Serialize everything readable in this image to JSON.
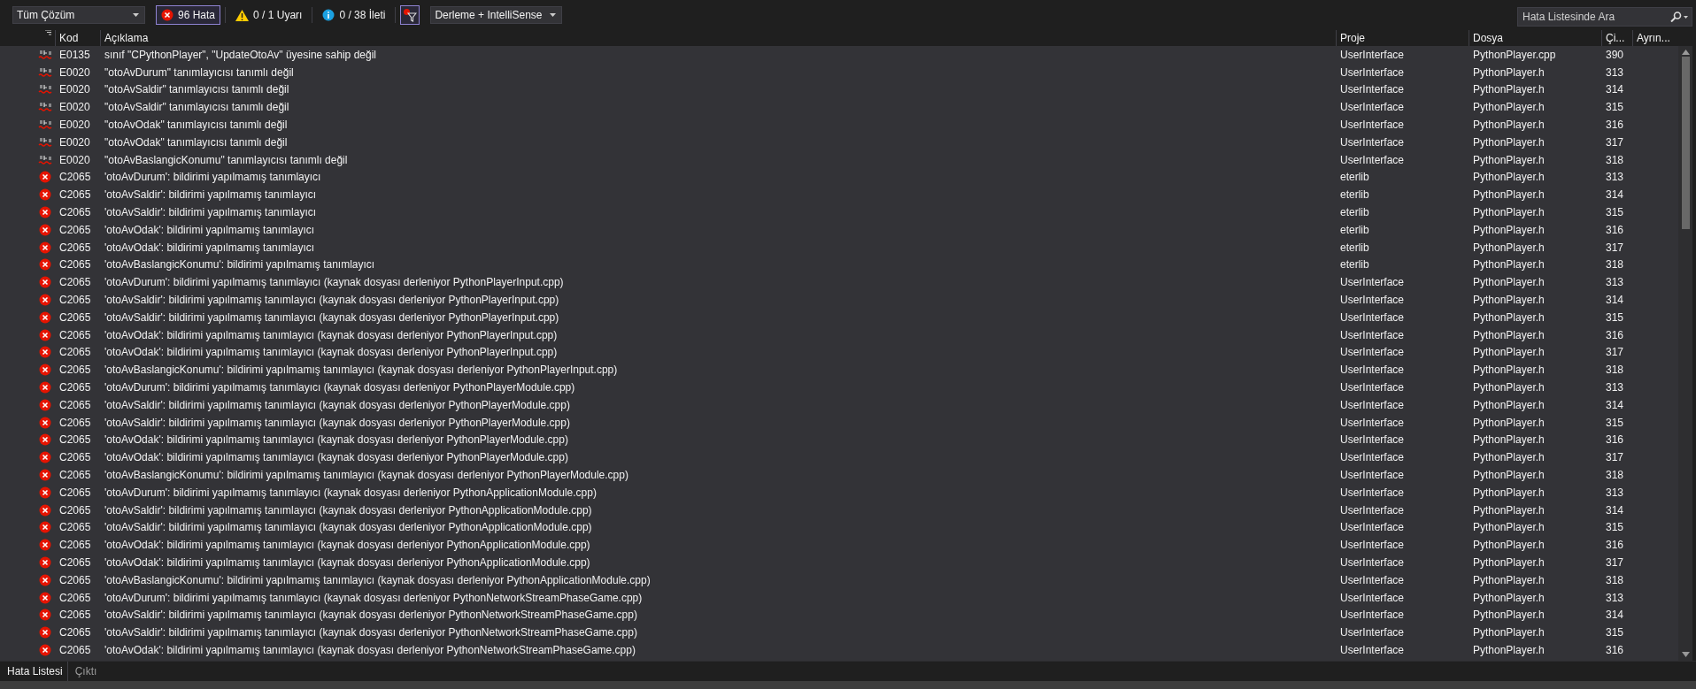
{
  "toolbar": {
    "scope": "Tüm Çözüm",
    "filters": [
      {
        "kind": "error",
        "label": "96 Hata",
        "selected": true
      },
      {
        "kind": "warning",
        "label": "0 / 1 Uyarı",
        "selected": false
      },
      {
        "kind": "info",
        "label": "0 / 38 İleti",
        "selected": false
      }
    ],
    "filter_toggle": {
      "selected": true
    },
    "build_source": "Derleme + IntelliSense",
    "search": {
      "placeholder": "Hata Listesinde Ara"
    }
  },
  "table": {
    "columns": [
      "Kod",
      "Açıklama",
      "Proje",
      "Dosya",
      "Çi...",
      "Ayrın..."
    ],
    "rows": [
      {
        "kind": "intellisense",
        "code": "E0135",
        "description": "sınıf \"CPythonPlayer\", \"UpdateOtoAv\" üyesine sahip değil",
        "project": "UserInterface",
        "file": "PythonPlayer.cpp",
        "line": "390"
      },
      {
        "kind": "intellisense",
        "code": "E0020",
        "description": "\"otoAvDurum\" tanımlayıcısı tanımlı değil",
        "project": "UserInterface",
        "file": "PythonPlayer.h",
        "line": "313"
      },
      {
        "kind": "intellisense",
        "code": "E0020",
        "description": "\"otoAvSaldir\" tanımlayıcısı tanımlı değil",
        "project": "UserInterface",
        "file": "PythonPlayer.h",
        "line": "314"
      },
      {
        "kind": "intellisense",
        "code": "E0020",
        "description": "\"otoAvSaldir\" tanımlayıcısı tanımlı değil",
        "project": "UserInterface",
        "file": "PythonPlayer.h",
        "line": "315"
      },
      {
        "kind": "intellisense",
        "code": "E0020",
        "description": "\"otoAvOdak\" tanımlayıcısı tanımlı değil",
        "project": "UserInterface",
        "file": "PythonPlayer.h",
        "line": "316"
      },
      {
        "kind": "intellisense",
        "code": "E0020",
        "description": "\"otoAvOdak\" tanımlayıcısı tanımlı değil",
        "project": "UserInterface",
        "file": "PythonPlayer.h",
        "line": "317"
      },
      {
        "kind": "intellisense",
        "code": "E0020",
        "description": "\"otoAvBaslangicKonumu\" tanımlayıcısı tanımlı değil",
        "project": "UserInterface",
        "file": "PythonPlayer.h",
        "line": "318"
      },
      {
        "kind": "error",
        "code": "C2065",
        "description": "'otoAvDurum': bildirimi yapılmamış tanımlayıcı",
        "project": "eterlib",
        "file": "PythonPlayer.h",
        "line": "313"
      },
      {
        "kind": "error",
        "code": "C2065",
        "description": "'otoAvSaldir': bildirimi yapılmamış tanımlayıcı",
        "project": "eterlib",
        "file": "PythonPlayer.h",
        "line": "314"
      },
      {
        "kind": "error",
        "code": "C2065",
        "description": "'otoAvSaldir': bildirimi yapılmamış tanımlayıcı",
        "project": "eterlib",
        "file": "PythonPlayer.h",
        "line": "315"
      },
      {
        "kind": "error",
        "code": "C2065",
        "description": "'otoAvOdak': bildirimi yapılmamış tanımlayıcı",
        "project": "eterlib",
        "file": "PythonPlayer.h",
        "line": "316"
      },
      {
        "kind": "error",
        "code": "C2065",
        "description": "'otoAvOdak': bildirimi yapılmamış tanımlayıcı",
        "project": "eterlib",
        "file": "PythonPlayer.h",
        "line": "317"
      },
      {
        "kind": "error",
        "code": "C2065",
        "description": "'otoAvBaslangicKonumu': bildirimi yapılmamış tanımlayıcı",
        "project": "eterlib",
        "file": "PythonPlayer.h",
        "line": "318"
      },
      {
        "kind": "error",
        "code": "C2065",
        "description": "'otoAvDurum': bildirimi yapılmamış tanımlayıcı (kaynak dosyası derleniyor PythonPlayerInput.cpp)",
        "project": "UserInterface",
        "file": "PythonPlayer.h",
        "line": "313"
      },
      {
        "kind": "error",
        "code": "C2065",
        "description": "'otoAvSaldir': bildirimi yapılmamış tanımlayıcı (kaynak dosyası derleniyor PythonPlayerInput.cpp)",
        "project": "UserInterface",
        "file": "PythonPlayer.h",
        "line": "314"
      },
      {
        "kind": "error",
        "code": "C2065",
        "description": "'otoAvSaldir': bildirimi yapılmamış tanımlayıcı (kaynak dosyası derleniyor PythonPlayerInput.cpp)",
        "project": "UserInterface",
        "file": "PythonPlayer.h",
        "line": "315"
      },
      {
        "kind": "error",
        "code": "C2065",
        "description": "'otoAvOdak': bildirimi yapılmamış tanımlayıcı (kaynak dosyası derleniyor PythonPlayerInput.cpp)",
        "project": "UserInterface",
        "file": "PythonPlayer.h",
        "line": "316"
      },
      {
        "kind": "error",
        "code": "C2065",
        "description": "'otoAvOdak': bildirimi yapılmamış tanımlayıcı (kaynak dosyası derleniyor PythonPlayerInput.cpp)",
        "project": "UserInterface",
        "file": "PythonPlayer.h",
        "line": "317"
      },
      {
        "kind": "error",
        "code": "C2065",
        "description": "'otoAvBaslangicKonumu': bildirimi yapılmamış tanımlayıcı (kaynak dosyası derleniyor PythonPlayerInput.cpp)",
        "project": "UserInterface",
        "file": "PythonPlayer.h",
        "line": "318"
      },
      {
        "kind": "error",
        "code": "C2065",
        "description": "'otoAvDurum': bildirimi yapılmamış tanımlayıcı (kaynak dosyası derleniyor PythonPlayerModule.cpp)",
        "project": "UserInterface",
        "file": "PythonPlayer.h",
        "line": "313"
      },
      {
        "kind": "error",
        "code": "C2065",
        "description": "'otoAvSaldir': bildirimi yapılmamış tanımlayıcı (kaynak dosyası derleniyor PythonPlayerModule.cpp)",
        "project": "UserInterface",
        "file": "PythonPlayer.h",
        "line": "314"
      },
      {
        "kind": "error",
        "code": "C2065",
        "description": "'otoAvSaldir': bildirimi yapılmamış tanımlayıcı (kaynak dosyası derleniyor PythonPlayerModule.cpp)",
        "project": "UserInterface",
        "file": "PythonPlayer.h",
        "line": "315"
      },
      {
        "kind": "error",
        "code": "C2065",
        "description": "'otoAvOdak': bildirimi yapılmamış tanımlayıcı (kaynak dosyası derleniyor PythonPlayerModule.cpp)",
        "project": "UserInterface",
        "file": "PythonPlayer.h",
        "line": "316"
      },
      {
        "kind": "error",
        "code": "C2065",
        "description": "'otoAvOdak': bildirimi yapılmamış tanımlayıcı (kaynak dosyası derleniyor PythonPlayerModule.cpp)",
        "project": "UserInterface",
        "file": "PythonPlayer.h",
        "line": "317"
      },
      {
        "kind": "error",
        "code": "C2065",
        "description": "'otoAvBaslangicKonumu': bildirimi yapılmamış tanımlayıcı (kaynak dosyası derleniyor PythonPlayerModule.cpp)",
        "project": "UserInterface",
        "file": "PythonPlayer.h",
        "line": "318"
      },
      {
        "kind": "error",
        "code": "C2065",
        "description": "'otoAvDurum': bildirimi yapılmamış tanımlayıcı (kaynak dosyası derleniyor PythonApplicationModule.cpp)",
        "project": "UserInterface",
        "file": "PythonPlayer.h",
        "line": "313"
      },
      {
        "kind": "error",
        "code": "C2065",
        "description": "'otoAvSaldir': bildirimi yapılmamış tanımlayıcı (kaynak dosyası derleniyor PythonApplicationModule.cpp)",
        "project": "UserInterface",
        "file": "PythonPlayer.h",
        "line": "314"
      },
      {
        "kind": "error",
        "code": "C2065",
        "description": "'otoAvSaldir': bildirimi yapılmamış tanımlayıcı (kaynak dosyası derleniyor PythonApplicationModule.cpp)",
        "project": "UserInterface",
        "file": "PythonPlayer.h",
        "line": "315"
      },
      {
        "kind": "error",
        "code": "C2065",
        "description": "'otoAvOdak': bildirimi yapılmamış tanımlayıcı (kaynak dosyası derleniyor PythonApplicationModule.cpp)",
        "project": "UserInterface",
        "file": "PythonPlayer.h",
        "line": "316"
      },
      {
        "kind": "error",
        "code": "C2065",
        "description": "'otoAvOdak': bildirimi yapılmamış tanımlayıcı (kaynak dosyası derleniyor PythonApplicationModule.cpp)",
        "project": "UserInterface",
        "file": "PythonPlayer.h",
        "line": "317"
      },
      {
        "kind": "error",
        "code": "C2065",
        "description": "'otoAvBaslangicKonumu': bildirimi yapılmamış tanımlayıcı (kaynak dosyası derleniyor PythonApplicationModule.cpp)",
        "project": "UserInterface",
        "file": "PythonPlayer.h",
        "line": "318"
      },
      {
        "kind": "error",
        "code": "C2065",
        "description": "'otoAvDurum': bildirimi yapılmamış tanımlayıcı (kaynak dosyası derleniyor PythonNetworkStreamPhaseGame.cpp)",
        "project": "UserInterface",
        "file": "PythonPlayer.h",
        "line": "313"
      },
      {
        "kind": "error",
        "code": "C2065",
        "description": "'otoAvSaldir': bildirimi yapılmamış tanımlayıcı (kaynak dosyası derleniyor PythonNetworkStreamPhaseGame.cpp)",
        "project": "UserInterface",
        "file": "PythonPlayer.h",
        "line": "314"
      },
      {
        "kind": "error",
        "code": "C2065",
        "description": "'otoAvSaldir': bildirimi yapılmamış tanımlayıcı (kaynak dosyası derleniyor PythonNetworkStreamPhaseGame.cpp)",
        "project": "UserInterface",
        "file": "PythonPlayer.h",
        "line": "315"
      },
      {
        "kind": "error",
        "code": "C2065",
        "description": "'otoAvOdak': bildirimi yapılmamış tanımlayıcı (kaynak dosyası derleniyor PythonNetworkStreamPhaseGame.cpp)",
        "project": "UserInterface",
        "file": "PythonPlayer.h",
        "line": "316"
      }
    ]
  },
  "tabs": [
    {
      "label": "Hata Listesi",
      "selected": true
    },
    {
      "label": "Çıktı",
      "selected": false
    }
  ]
}
